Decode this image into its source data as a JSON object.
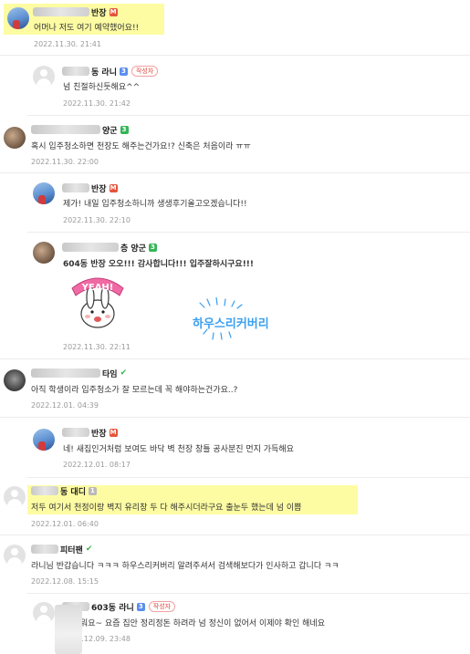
{
  "comments": [
    {
      "nick_suffix": "반장",
      "text": "어머나 저도 여기 예약했어요!!",
      "date": "2022.11.30. 21:41"
    },
    {
      "nick_suffix": "동 라니",
      "author_badge": "작성자",
      "text": "넘 친절하신듯해요^^",
      "date": "2022.11.30. 21:42"
    },
    {
      "nick_suffix": "양군",
      "text": "혹시 입주청소하면 천장도 해주는건가요!? 신축은 처음이라 ㅠㅠ",
      "date": "2022.11.30. 22:00"
    },
    {
      "nick_suffix": "반장",
      "text": "제가! 내일 입주청소하니까 생생후기올고오겠습니다!!",
      "date": "2022.11.30. 22:10"
    },
    {
      "nick_suffix": "층 양군",
      "text": "604동 반장 오오!!! 감사합니다!!! 입주잘하시구요!!!",
      "date": "2022.11.30. 22:11"
    },
    {
      "nick_suffix": "타임",
      "text": "아직 학생이라 입주청소가 잘 모르는데 꼭 해야하는건가요..?",
      "date": "2022.12.01. 04:39"
    },
    {
      "nick_suffix": "반장",
      "text": "네! 새집인거처럼 보여도 바닥 벽 천장 창틀 공사분진 먼지 가득해요",
      "date": "2022.12.01. 08:17"
    },
    {
      "nick_suffix": "동 대디",
      "text": "저두 여기서 천정이랑 벽지 유리창 두 다 해주시더라구요 출눈두 했는데 넘 이쁨",
      "date": "2022.12.01. 06:40"
    },
    {
      "nick_suffix": "피터팬",
      "text": "라니님 반갑습니다 ㅋㅋㅋ 하우스리커버리 알려주셔서 검색해보다가 인사하고 갑니다 ㅋㅋ",
      "date": "2022.12.08. 15:15"
    },
    {
      "nick_suffix": "603동 라니",
      "author_badge": "작성자",
      "text": "워요~ 요즘 집안 정리정돈 하려라 넘 정신이 없어서 이제야 확인 해네요",
      "date": "2022.12.09. 23:48"
    }
  ],
  "stickers": {
    "yeah_text": "YEAH!",
    "brand_text": "하우스리커버리"
  },
  "colors": {
    "highlight": "#fdfca3",
    "author_badge": "#e0463a",
    "sticker_blue": "#3a9ff0"
  }
}
